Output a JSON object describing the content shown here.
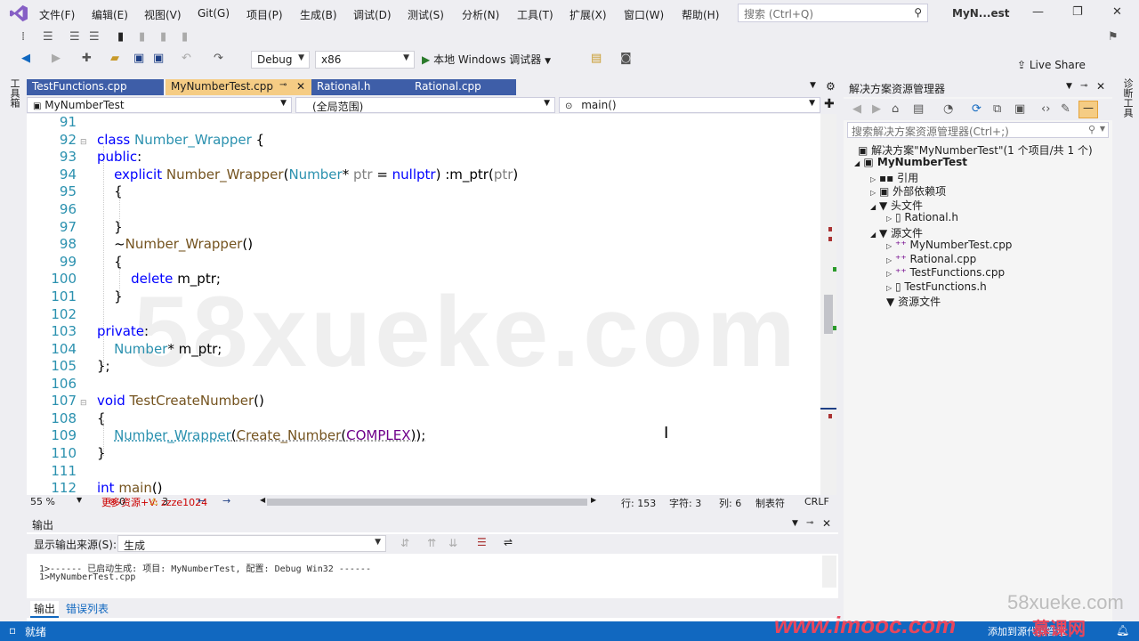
{
  "menubar": {
    "items": [
      "文件(F)",
      "编辑(E)",
      "视图(V)",
      "Git(G)",
      "项目(P)",
      "生成(B)",
      "调试(D)",
      "测试(S)",
      "分析(N)",
      "工具(T)",
      "扩展(X)",
      "窗口(W)",
      "帮助(H)"
    ],
    "search_placeholder": "搜索 (Ctrl+Q)",
    "window_title": "MyN...est"
  },
  "toolbar": {
    "config": "Debug",
    "platform": "x86",
    "run_label": "本地 Windows 调试器",
    "live_share": "Live Share"
  },
  "left_strip": {
    "toolbox": "工具箱"
  },
  "right_strip": {
    "props": "诊断工具"
  },
  "doc_tabs": [
    "TestFunctions.cpp",
    "MyNumberTest.cpp",
    "Rational.h",
    "Rational.cpp"
  ],
  "nav": {
    "project": "MyNumberTest",
    "scope": "(全局范围)",
    "member": "main()"
  },
  "editor": {
    "line_numbers": [
      "91",
      "92",
      "93",
      "94",
      "95",
      "96",
      "97",
      "98",
      "99",
      "100",
      "101",
      "102",
      "103",
      "104",
      "105",
      "106",
      "107",
      "108",
      "109",
      "110",
      "111",
      "112"
    ],
    "watermark": "58xueke.com"
  },
  "status_row": {
    "zoom": "55 %",
    "errors": "0",
    "warnings": "3",
    "line": "行: 153",
    "char": "字符: 3",
    "col": "列: 6",
    "tabs": "制表符",
    "eol": "CRLF",
    "promo": "更多资源+V: zzze1024"
  },
  "solution": {
    "title": "解决方案资源管理器",
    "search_placeholder": "搜索解决方案资源管理器(Ctrl+;)",
    "solution_label": "解决方案\"MyNumberTest\"(1 个项目/共 1 个)",
    "project": "MyNumberTest",
    "items": [
      "引用",
      "外部依赖项",
      "头文件",
      "Rational.h",
      "源文件",
      "MyNumberTest.cpp",
      "Rational.cpp",
      "TestFunctions.cpp",
      "TestFunctions.h",
      "资源文件"
    ]
  },
  "output": {
    "title": "输出",
    "source_label": "显示输出来源(S):",
    "source_value": "生成",
    "lines": [
      "1>------ 已启动生成: 项目: MyNumberTest, 配置: Debug Win32 ------",
      "1>MyNumberTest.cpp"
    ],
    "tabs": [
      "输出",
      "错误列表"
    ]
  },
  "statusbar": {
    "ready": "就绪",
    "add_source": "添加到源代码管理"
  },
  "watermarks": {
    "imooc": "www.imooc.com",
    "site": "58xueke.com",
    "brand": "慕课网"
  }
}
